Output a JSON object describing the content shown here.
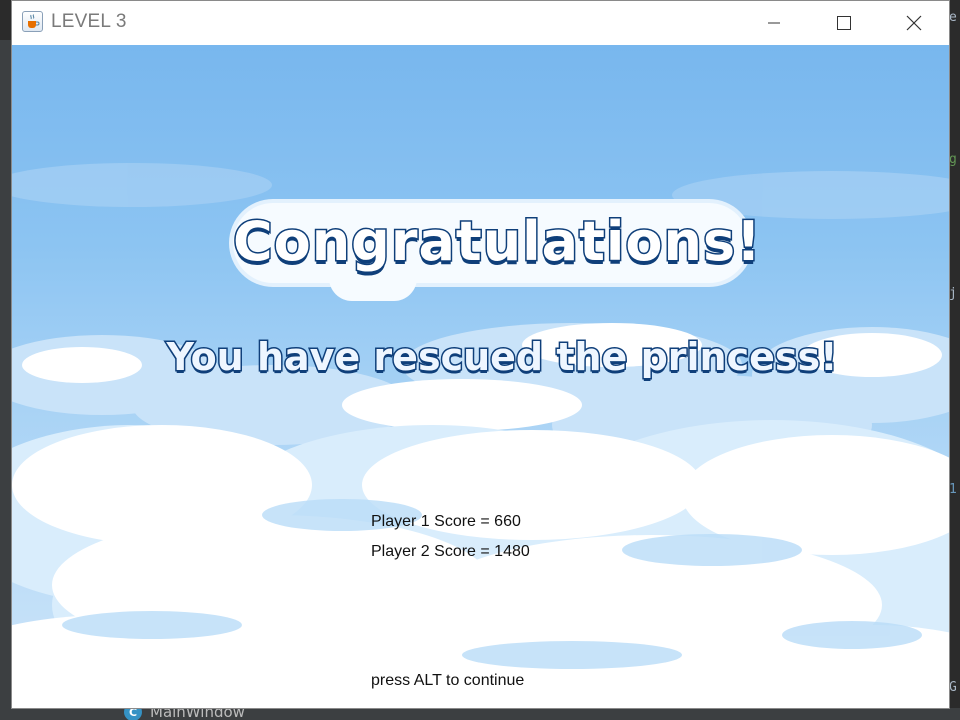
{
  "window": {
    "title": "LEVEL 3",
    "app_icon": "java-cup-icon",
    "controls": {
      "minimize_icon": "minimize-icon",
      "maximize_icon": "maximize-icon",
      "close_icon": "close-icon"
    }
  },
  "game": {
    "headline": "Congratulations!",
    "message": "You have rescued the princess!",
    "scores": [
      {
        "label": "Player 1 Score = ",
        "value": "660"
      },
      {
        "label": "Player 2 Score = ",
        "value": "1480"
      }
    ],
    "hint": "press ALT to continue"
  },
  "background_ide": {
    "bottom_label": "MainWindow",
    "bottom_icon": "class-c-icon",
    "right_edge_fragments": [
      "e",
      "g",
      "j",
      "1",
      "G"
    ]
  },
  "colors": {
    "sky_top": "#78b7ee",
    "sky_bottom": "#cfe6fa",
    "title_outline": "#0f3f7a",
    "cloud": "#ffffff",
    "cloud_shade": "#c9e3f9"
  }
}
